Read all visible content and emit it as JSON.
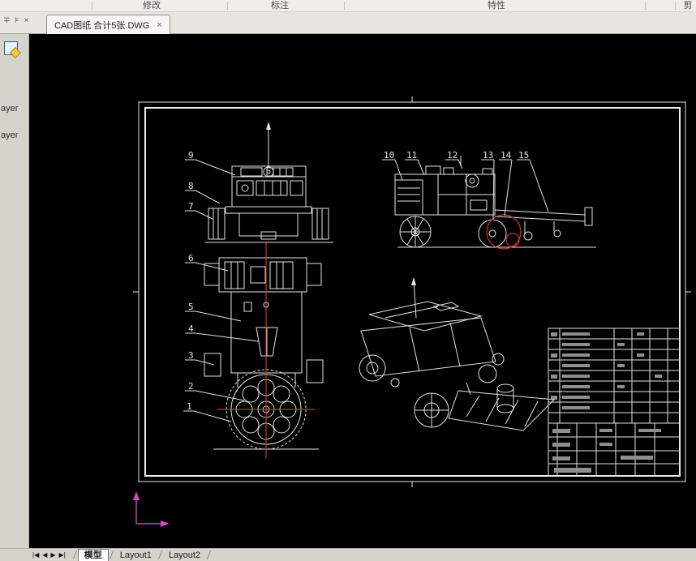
{
  "ribbon": {
    "groups": [
      {
        "label": "修改"
      },
      {
        "label": "标注"
      },
      {
        "label": "特性"
      }
    ],
    "partial_right": "剪"
  },
  "palette": {
    "dock_icon": "∓",
    "pin_icon": "⊧",
    "close_icon": "×",
    "layer_partial_labels": [
      "ayer",
      "ayer"
    ]
  },
  "file_tab": {
    "title": "CAD图纸 合计5张.DWG",
    "close_icon": "×"
  },
  "drawing": {
    "labels_front": [
      "9",
      "8",
      "7"
    ],
    "labels_side": [
      "10",
      "11",
      "12",
      "13",
      "14",
      "15"
    ],
    "labels_plan": [
      "6",
      "5",
      "4",
      "3",
      "2",
      "1"
    ]
  },
  "statusbar": {
    "nav": [
      "|◀",
      "◀",
      "▶",
      "▶|"
    ],
    "tabs": [
      {
        "label": "模型",
        "active": true
      },
      {
        "label": "Layout1",
        "active": false
      },
      {
        "label": "Layout2",
        "active": false
      }
    ]
  },
  "colors": {
    "canvas_bg": "#000000",
    "line": "#e3e3e3",
    "accent_red": "#d03434",
    "ucs_magenta": "#c84ec8",
    "ui_bg": "#d6d2cc"
  }
}
